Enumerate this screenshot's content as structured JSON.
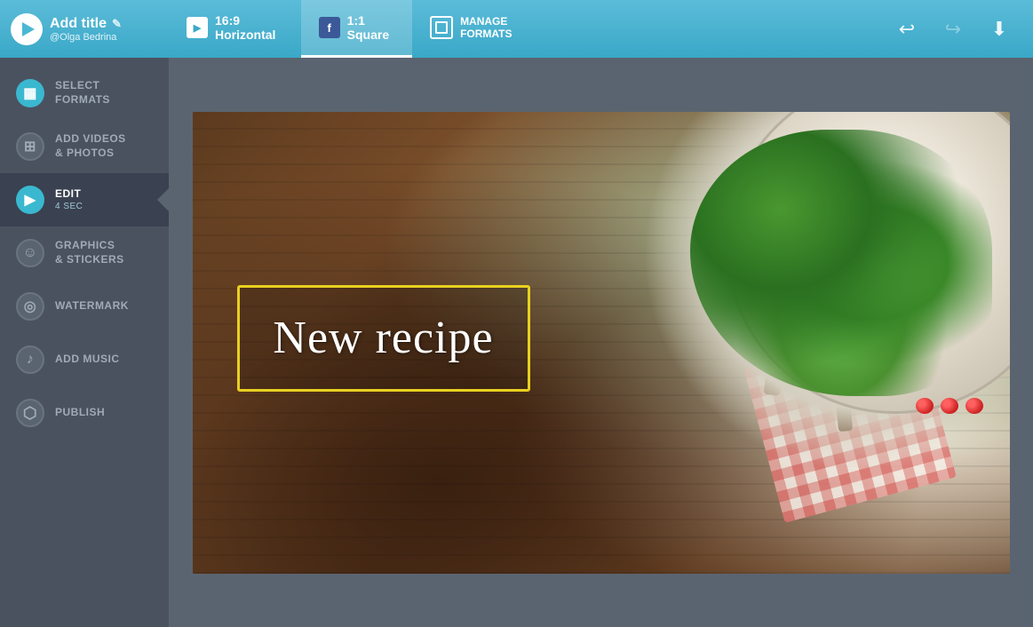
{
  "header": {
    "brand": {
      "title": "Add title",
      "subtitle": "@Olga Bedrina",
      "edit_icon": "✎"
    },
    "tabs": [
      {
        "id": "horizontal",
        "icon_type": "blue",
        "icon_text": "▶",
        "label": "16:9 Horizontal",
        "active": false
      },
      {
        "id": "square",
        "icon_type": "fb",
        "icon_text": "f",
        "label": "1:1 Square",
        "active": true
      },
      {
        "id": "manage",
        "icon_type": "manage",
        "icon_text": "",
        "label": "MANAGE\nFORMATS",
        "active": false
      }
    ],
    "actions": {
      "undo_label": "↩",
      "redo_label": "↪",
      "download_label": "⬇"
    }
  },
  "sidebar": {
    "items": [
      {
        "id": "select-formats",
        "label": "SELECT\nFORMATS",
        "icon": "▦",
        "active": false
      },
      {
        "id": "add-videos",
        "label": "ADD VIDEOS\n& PHOTOS",
        "icon": "⊞",
        "active": false
      },
      {
        "id": "edit",
        "label": "EDIT",
        "sublabel": "4 sec",
        "icon": "▶",
        "active": true
      },
      {
        "id": "graphics",
        "label": "GRAPHICS\n& STICKERS",
        "icon": "☺",
        "active": false
      },
      {
        "id": "watermark",
        "label": "WATERMARK",
        "icon": "◎",
        "active": false
      },
      {
        "id": "add-music",
        "label": "ADD MUSIC",
        "icon": "♪",
        "active": false
      },
      {
        "id": "publish",
        "label": "PUBLISH",
        "icon": "◎",
        "active": false
      }
    ]
  },
  "canvas": {
    "recipe_text": "New recipe"
  }
}
